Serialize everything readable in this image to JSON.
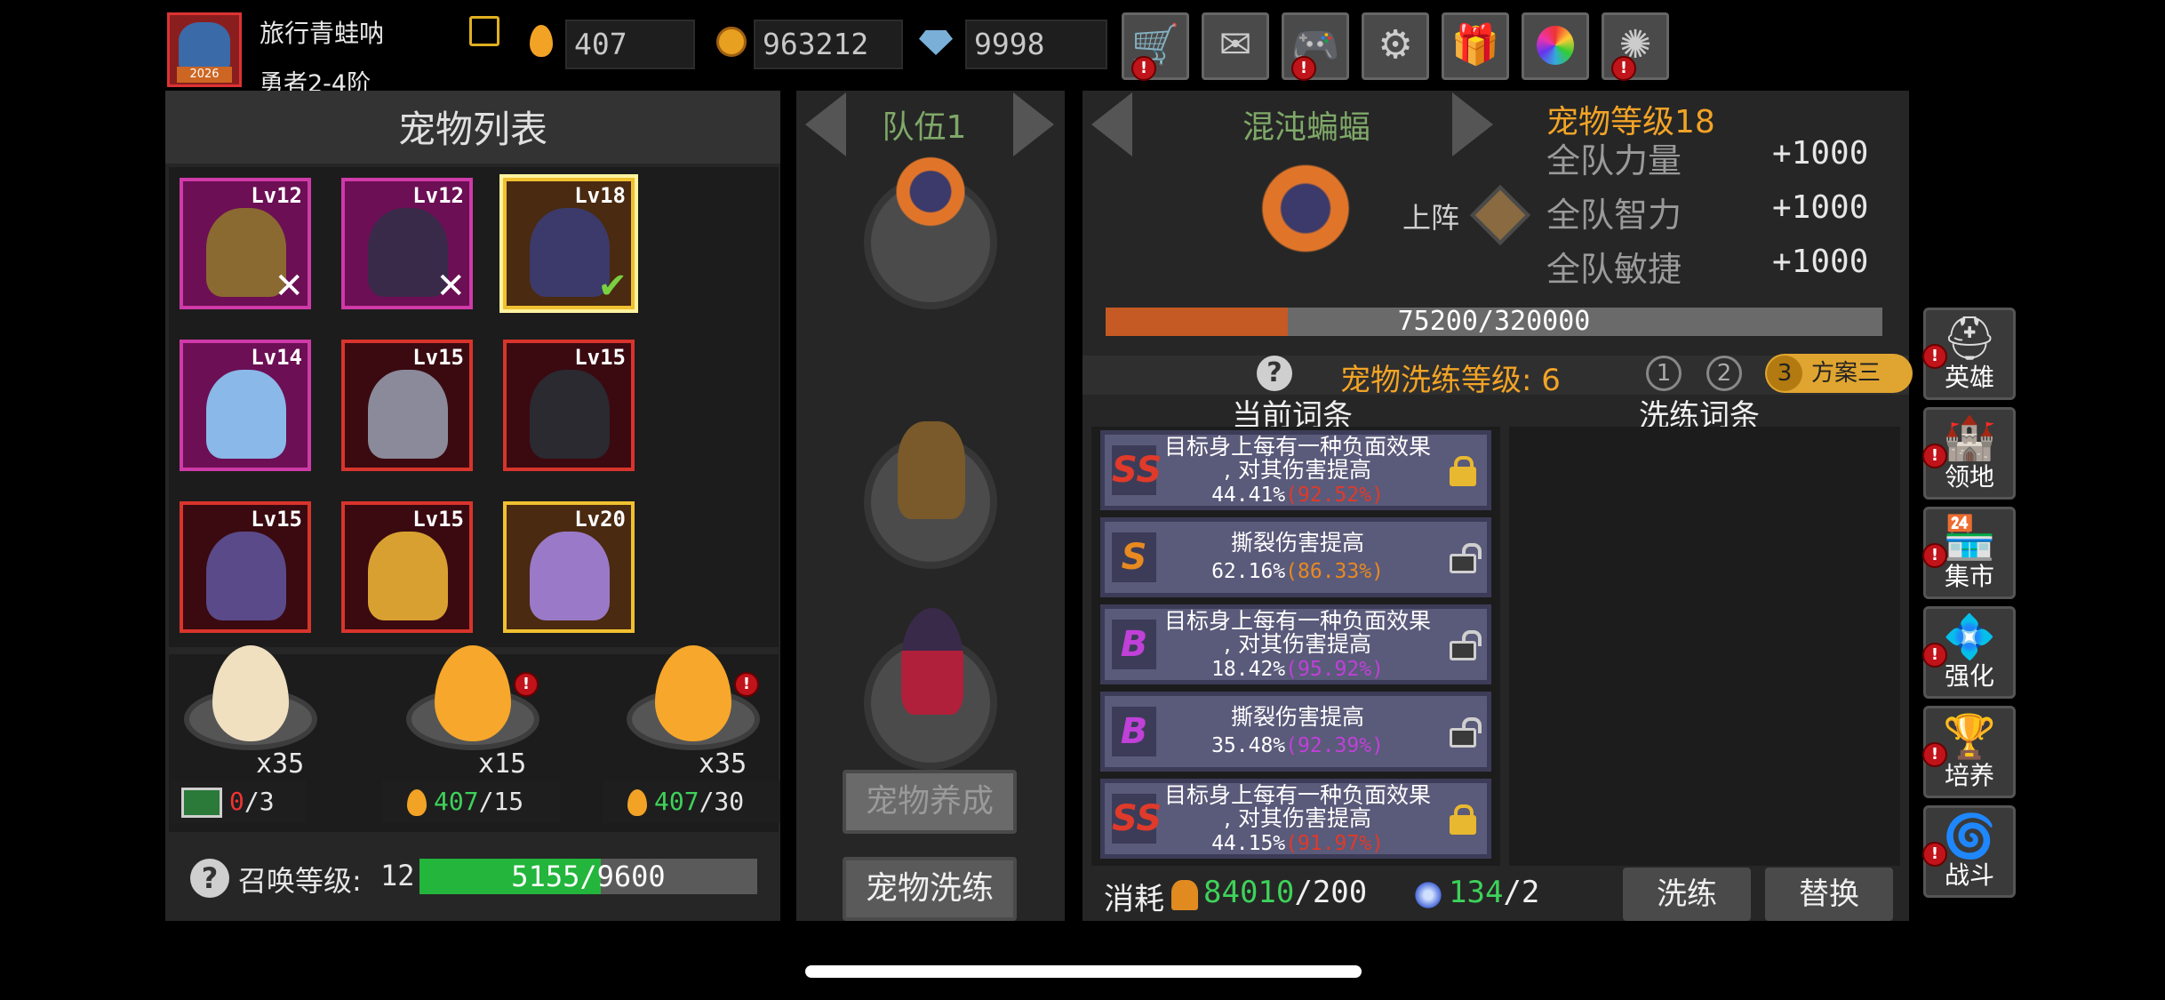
{
  "player": {
    "name": "旅行青蛙呐",
    "rank": "勇者2-4阶",
    "avatar_tag": "2026"
  },
  "resources": {
    "eggs": "407",
    "gold": "963212",
    "diamonds": "9998"
  },
  "top_buttons": [
    "shop-cart-icon",
    "mail-icon",
    "gamepad-icon",
    "settings-gear-icon",
    "gift-icon",
    "color-wheel-icon",
    "fireworks-icon"
  ],
  "pet_list": {
    "title": "宠物列表",
    "pets": [
      {
        "level": "Lv12",
        "mark": "✕",
        "art": "treant",
        "border": "#cf3aa8"
      },
      {
        "level": "Lv12",
        "mark": "✕",
        "art": "witch",
        "border": "#cf3aa8"
      },
      {
        "level": "Lv18",
        "mark": "✔",
        "art": "chaos-bat",
        "border": "#f0c030"
      },
      {
        "level": "Lv14",
        "mark": "",
        "art": "ice-ghost",
        "border": "#cf3aa8"
      },
      {
        "level": "Lv15",
        "mark": "",
        "art": "grey-bat",
        "border": "#d8342c"
      },
      {
        "level": "Lv15",
        "mark": "",
        "art": "reaper",
        "border": "#d8342c"
      },
      {
        "level": "Lv15",
        "mark": "",
        "art": "purple-pony",
        "border": "#d8342c"
      },
      {
        "level": "Lv15",
        "mark": "",
        "art": "flame-skull",
        "border": "#d8342c"
      },
      {
        "level": "Lv20",
        "mark": "",
        "art": "scorpion",
        "border": "#f0c030"
      }
    ]
  },
  "eggs": [
    {
      "count": "x35",
      "cost_have": "0",
      "cost_need": "/3",
      "cost_icon": "video-ad-icon"
    },
    {
      "count": "x15",
      "cost_have": "407",
      "cost_need": "/15",
      "cost_icon": "egg-icon"
    },
    {
      "count": "x35",
      "cost_have": "407",
      "cost_need": "/30",
      "cost_icon": "egg-icon"
    }
  ],
  "summon": {
    "label": "召唤等级:",
    "level": "12",
    "progress_text": "5155/9600",
    "progress": 0.537
  },
  "team": {
    "title": "队伍1",
    "cultivate_button": "宠物养成",
    "refine_button": "宠物洗练"
  },
  "pet_detail": {
    "name": "混沌蝙蝠",
    "level_label": "宠物等级18",
    "deploy_label": "上阵",
    "attributes": [
      {
        "name": "全队力量",
        "value": "+1000"
      },
      {
        "name": "全队智力",
        "value": "+1000"
      },
      {
        "name": "全队敏捷",
        "value": "+1000"
      }
    ],
    "exp_text": "75200/320000",
    "exp": 0.235
  },
  "refine": {
    "level_label": "宠物洗练等级: 6",
    "plans": [
      "1",
      "2",
      "3"
    ],
    "active_plan_label": "方案三",
    "current_header": "当前词条",
    "refined_header": "洗练词条",
    "affixes": [
      {
        "grade": "SS",
        "grade_color": "#e03a2a",
        "line1": "目标身上每有一种负面效果",
        "line2": ", 对其伤害提高",
        "pct": "44.41%",
        "max": "(92.52%)",
        "max_color": "#e03a2a",
        "locked": true
      },
      {
        "grade": "S",
        "grade_color": "#e88a20",
        "line1": "",
        "line2": "撕裂伤害提高",
        "pct": "62.16%",
        "max": "(86.33%)",
        "max_color": "#e88a20",
        "locked": false
      },
      {
        "grade": "B",
        "grade_color": "#c040d8",
        "line1": "目标身上每有一种负面效果",
        "line2": ", 对其伤害提高",
        "pct": "18.42%",
        "max": "(95.92%)",
        "max_color": "#c040d8",
        "locked": false
      },
      {
        "grade": "B",
        "grade_color": "#c040d8",
        "line1": "",
        "line2": "撕裂伤害提高",
        "pct": "35.48%",
        "max": "(92.39%)",
        "max_color": "#c040d8",
        "locked": false
      },
      {
        "grade": "SS",
        "grade_color": "#e03a2a",
        "line1": "目标身上每有一种负面效果",
        "line2": ", 对其伤害提高",
        "pct": "44.15%",
        "max": "(91.97%)",
        "max_color": "#e03a2a",
        "locked": true
      }
    ],
    "cost_label": "消耗",
    "cost1_have": "84010",
    "cost1_need": "/200",
    "cost2_have": "134",
    "cost2_need": "/2",
    "refine_button": "洗练",
    "replace_button": "替换"
  },
  "side_nav": [
    {
      "label": "英雄",
      "icon": "helmet-icon"
    },
    {
      "label": "领地",
      "icon": "castle-icon"
    },
    {
      "label": "集市",
      "icon": "market-icon"
    },
    {
      "label": "强化",
      "icon": "enhance-crystal-icon"
    },
    {
      "label": "培养",
      "icon": "chalice-icon"
    },
    {
      "label": "战斗",
      "icon": "portal-icon"
    }
  ]
}
